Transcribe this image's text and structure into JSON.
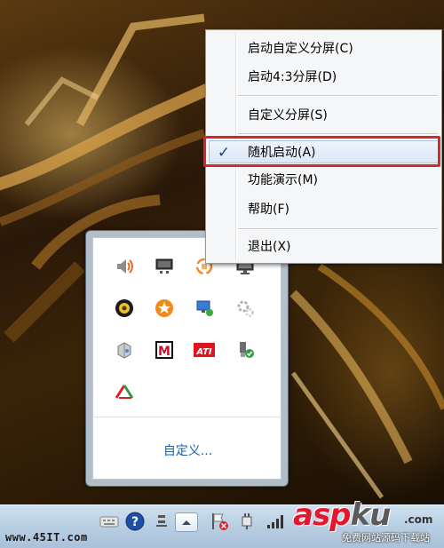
{
  "context_menu": {
    "items": [
      {
        "label": "启动自定义分屏(C)",
        "checked": false
      },
      {
        "label": "启动4:3分屏(D)",
        "checked": false
      },
      {
        "label": "自定义分屏(S)",
        "checked": false
      },
      {
        "label": "随机启动(A)",
        "checked": true
      },
      {
        "label": "功能演示(M)",
        "checked": false
      },
      {
        "label": "帮助(F)",
        "checked": false
      },
      {
        "label": "退出(X)",
        "checked": false
      }
    ],
    "check_mark": "✓",
    "highlight_color": "#d9252c"
  },
  "tray_popup": {
    "icons": [
      "volume-icon",
      "monitor-icon",
      "orange-sync-icon",
      "network-display-icon",
      "yellow-circle-icon",
      "orange-star-icon",
      "network-connection-icon",
      "gear-icon",
      "disk-icon",
      "mcafee-icon",
      "ati-icon",
      "usb-safe-remove-icon",
      "red-triangle-icon"
    ],
    "customize_label": "自定义..."
  },
  "taskbar": {
    "left_watermark": "www.45IT.com",
    "logo_brand_red": "asp",
    "logo_brand_gray": "ku",
    "logo_domain": ".com",
    "logo_tagline": "免费网站源码下载站"
  }
}
